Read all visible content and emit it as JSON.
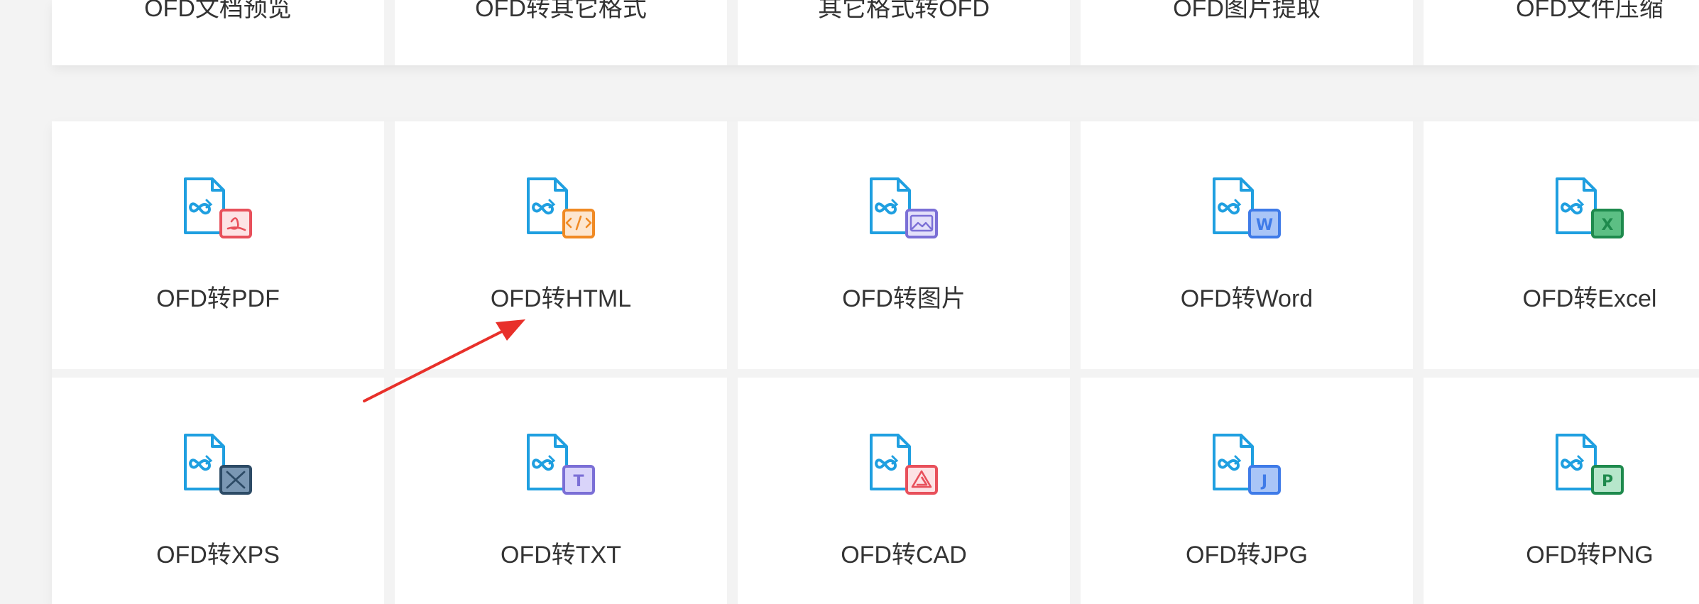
{
  "top_tabs": [
    {
      "label": "OFD文档预览"
    },
    {
      "label": "OFD转其它格式"
    },
    {
      "label": "其它格式转OFD"
    },
    {
      "label": "OFD图片提取"
    },
    {
      "label": "OFD文件压缩"
    }
  ],
  "tools": [
    {
      "label": "OFD转PDF",
      "icon": "ofd-to-pdf-icon",
      "badge": "pdf",
      "color": "#e8505b",
      "fill": "#fde3e5"
    },
    {
      "label": "OFD转HTML",
      "icon": "ofd-to-html-icon",
      "badge": "code",
      "color": "#f08a24",
      "fill": "#fde6cf"
    },
    {
      "label": "OFD转图片",
      "icon": "ofd-to-image-icon",
      "badge": "image",
      "color": "#7b6fd6",
      "fill": "#e3e0fa"
    },
    {
      "label": "OFD转Word",
      "icon": "ofd-to-word-icon",
      "badge": "W",
      "color": "#3f7be8",
      "fill": "#a9c5f7"
    },
    {
      "label": "OFD转Excel",
      "icon": "ofd-to-excel-icon",
      "badge": "X",
      "color": "#1e8a4d",
      "fill": "#5cbf84"
    },
    {
      "label": "OFD转XPS",
      "icon": "ofd-to-xps-icon",
      "badge": "xps",
      "color": "#2d4b66",
      "fill": "#7a97b3"
    },
    {
      "label": "OFD转TXT",
      "icon": "ofd-to-txt-icon",
      "badge": "T",
      "color": "#7b6fd6",
      "fill": "#d9d4fa"
    },
    {
      "label": "OFD转CAD",
      "icon": "ofd-to-cad-icon",
      "badge": "cad",
      "color": "#e8505b",
      "fill": "#fde3e5"
    },
    {
      "label": "OFD转JPG",
      "icon": "ofd-to-jpg-icon",
      "badge": "J",
      "color": "#3f7be8",
      "fill": "#a9c5f7"
    },
    {
      "label": "OFD转PNG",
      "icon": "ofd-to-png-icon",
      "badge": "P",
      "color": "#1e8a4d",
      "fill": "#b6e6cb"
    }
  ],
  "colors": {
    "doc_blue": "#1f9fe0",
    "annotation_arrow": "#e8302a",
    "background": "#f3f3f3",
    "card": "#ffffff"
  }
}
